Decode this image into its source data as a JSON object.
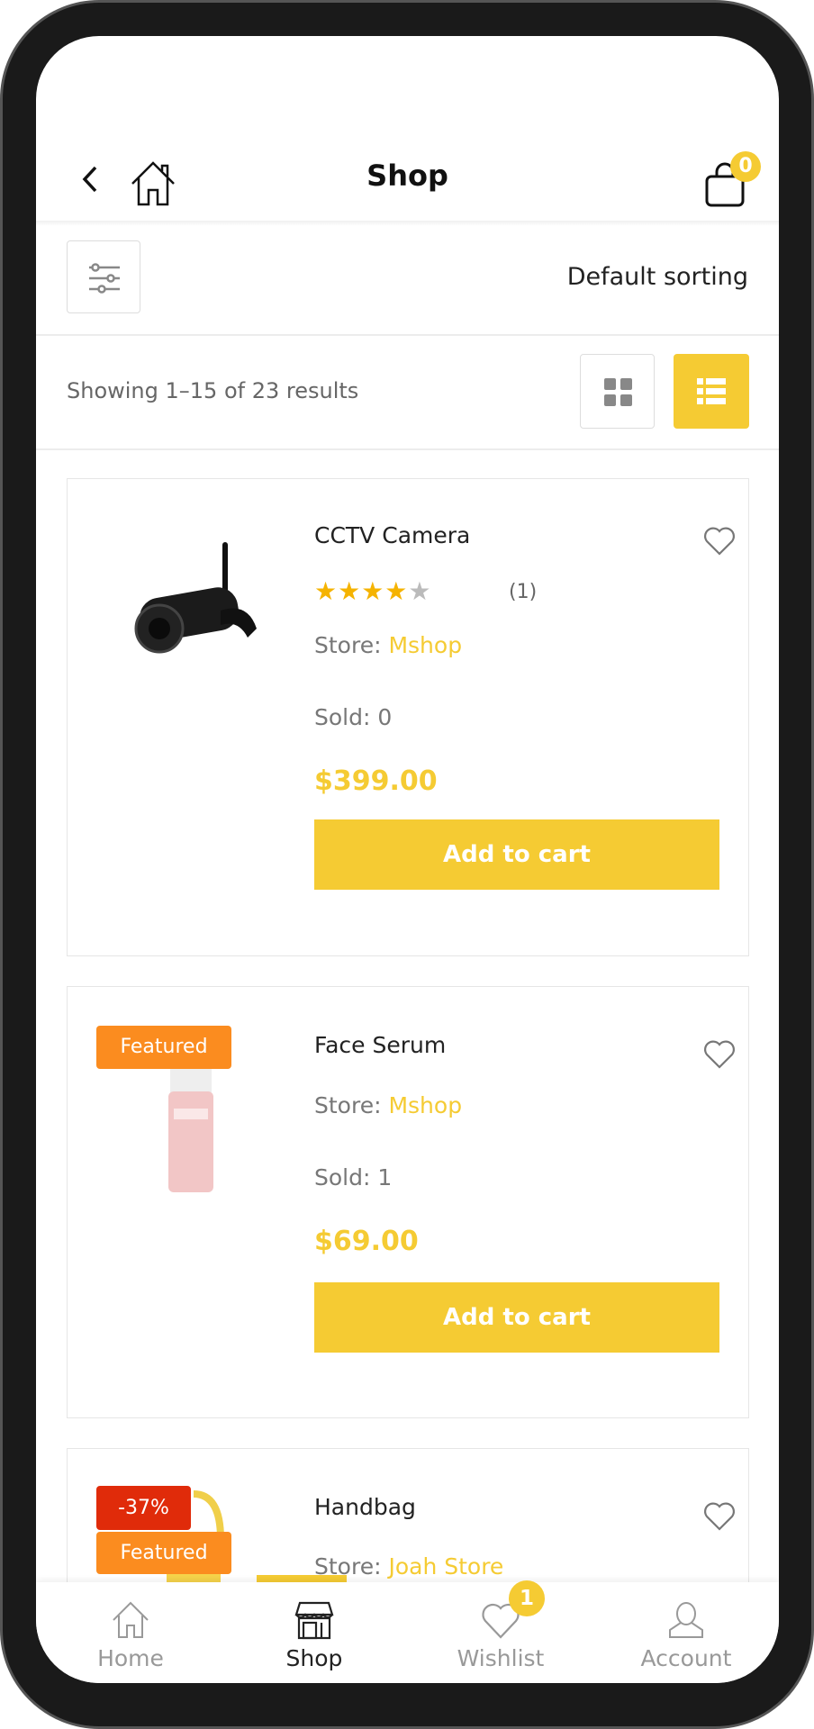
{
  "header": {
    "title": "Shop",
    "cart_count": "0"
  },
  "toolbar": {
    "sort_label": "Default sorting",
    "results_text": "Showing 1–15 of 23 results",
    "view_mode": "list"
  },
  "colors": {
    "accent": "#f5cb33",
    "featured": "#fb8c1f",
    "discount": "#e02b0a"
  },
  "products": [
    {
      "name": "CCTV Camera",
      "rating": 4,
      "review_count": "(1)",
      "store_label": "Store: ",
      "store": "Mshop",
      "sold": "Sold: 0",
      "price": "$399.00",
      "cta": "Add to cart",
      "wishlisted": false
    },
    {
      "name": "Face Serum",
      "badge": "Featured",
      "store_label": "Store: ",
      "store": "Mshop",
      "sold": "Sold: 1",
      "price": "$69.00",
      "cta": "Add to cart",
      "wishlisted": false
    },
    {
      "name": "Handbag",
      "discount": "-37%",
      "badge": "Featured",
      "store_label": "Store: ",
      "store": "Joah Store"
    }
  ],
  "nav": {
    "items": [
      {
        "label": "Home",
        "icon": "home-icon"
      },
      {
        "label": "Shop",
        "icon": "store-icon",
        "active": true
      },
      {
        "label": "Wishlist",
        "icon": "heart-icon",
        "count": "1"
      },
      {
        "label": "Account",
        "icon": "user-icon"
      }
    ]
  }
}
